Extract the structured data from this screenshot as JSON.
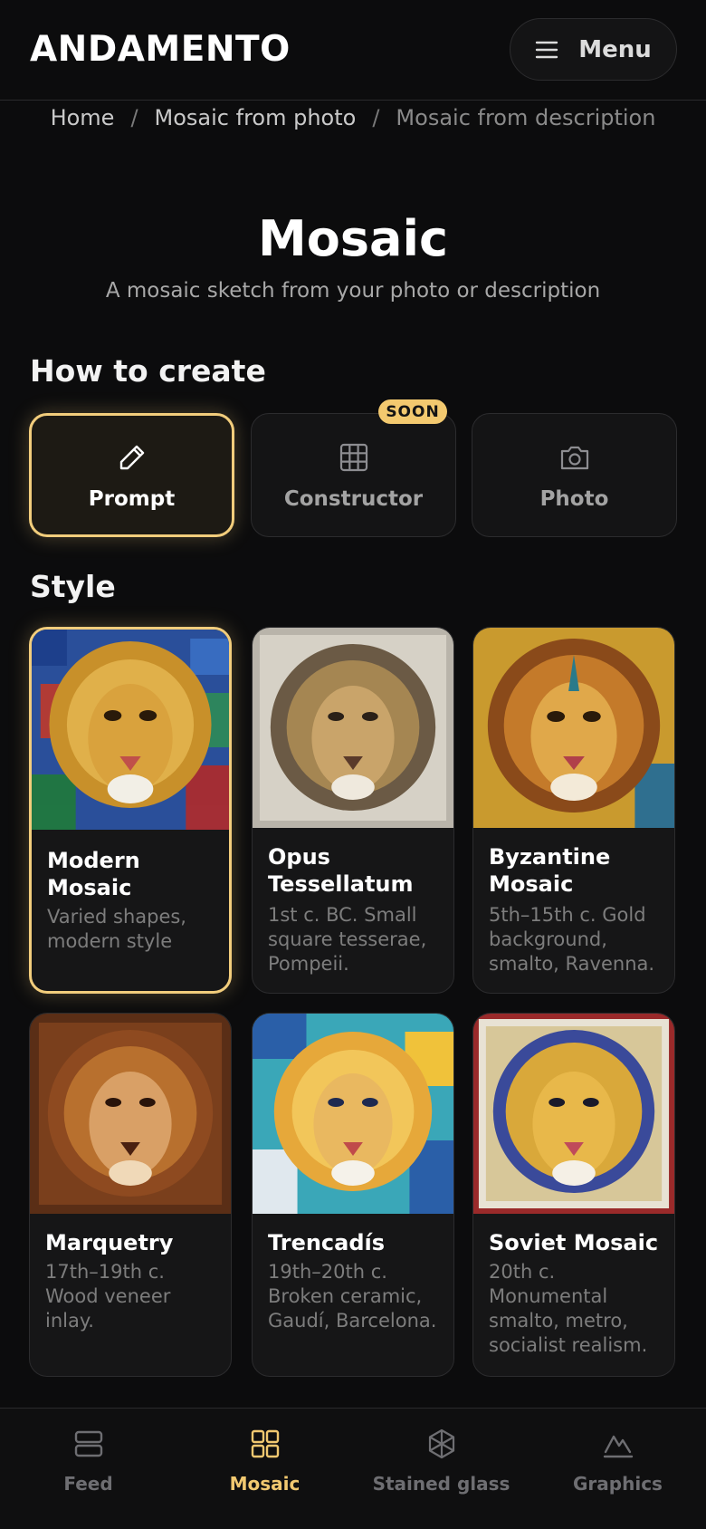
{
  "header": {
    "brand": "ANDAMENTO",
    "menu_label": "Menu"
  },
  "breadcrumb": [
    "Home",
    "Mosaic from photo",
    "Mosaic from description"
  ],
  "page": {
    "title": "Mosaic",
    "subtitle": "A mosaic sketch from your photo or description"
  },
  "sections": {
    "how_to_create": "How to create",
    "style": "Style"
  },
  "methods": [
    {
      "label": "Prompt",
      "icon": "pencil-icon",
      "selected": true
    },
    {
      "label": "Constructor",
      "icon": "grid-icon",
      "badge": "SOON"
    },
    {
      "label": "Photo",
      "icon": "camera-icon"
    }
  ],
  "styles": [
    {
      "name": "Modern Mosaic",
      "desc": "Varied shapes, modern style",
      "selected": true
    },
    {
      "name": "Opus Tessellatum",
      "desc": "1st c. BC. Small square tesserae, Pompeii."
    },
    {
      "name": "Byzantine Mosaic",
      "desc": "5th–15th c. Gold background, smalto, Ravenna."
    },
    {
      "name": "Marquetry",
      "desc": "17th–19th c. Wood veneer inlay."
    },
    {
      "name": "Trencadís",
      "desc": "19th–20th c. Broken ceramic, Gaudí, Barcelona."
    },
    {
      "name": "Soviet Mosaic",
      "desc": "20th c. Monumental smalto, metro, socialist realism."
    }
  ],
  "bottom_nav": [
    {
      "label": "Feed",
      "icon": "feed-icon"
    },
    {
      "label": "Mosaic",
      "icon": "mosaic-grid-icon",
      "active": true
    },
    {
      "label": "Stained glass",
      "icon": "stained-glass-icon"
    },
    {
      "label": "Graphics",
      "icon": "graphics-icon"
    }
  ],
  "colors": {
    "accent": "#f2cd7c",
    "background": "#0c0c0d",
    "card": "#161617",
    "badge": "#f3c96f"
  }
}
